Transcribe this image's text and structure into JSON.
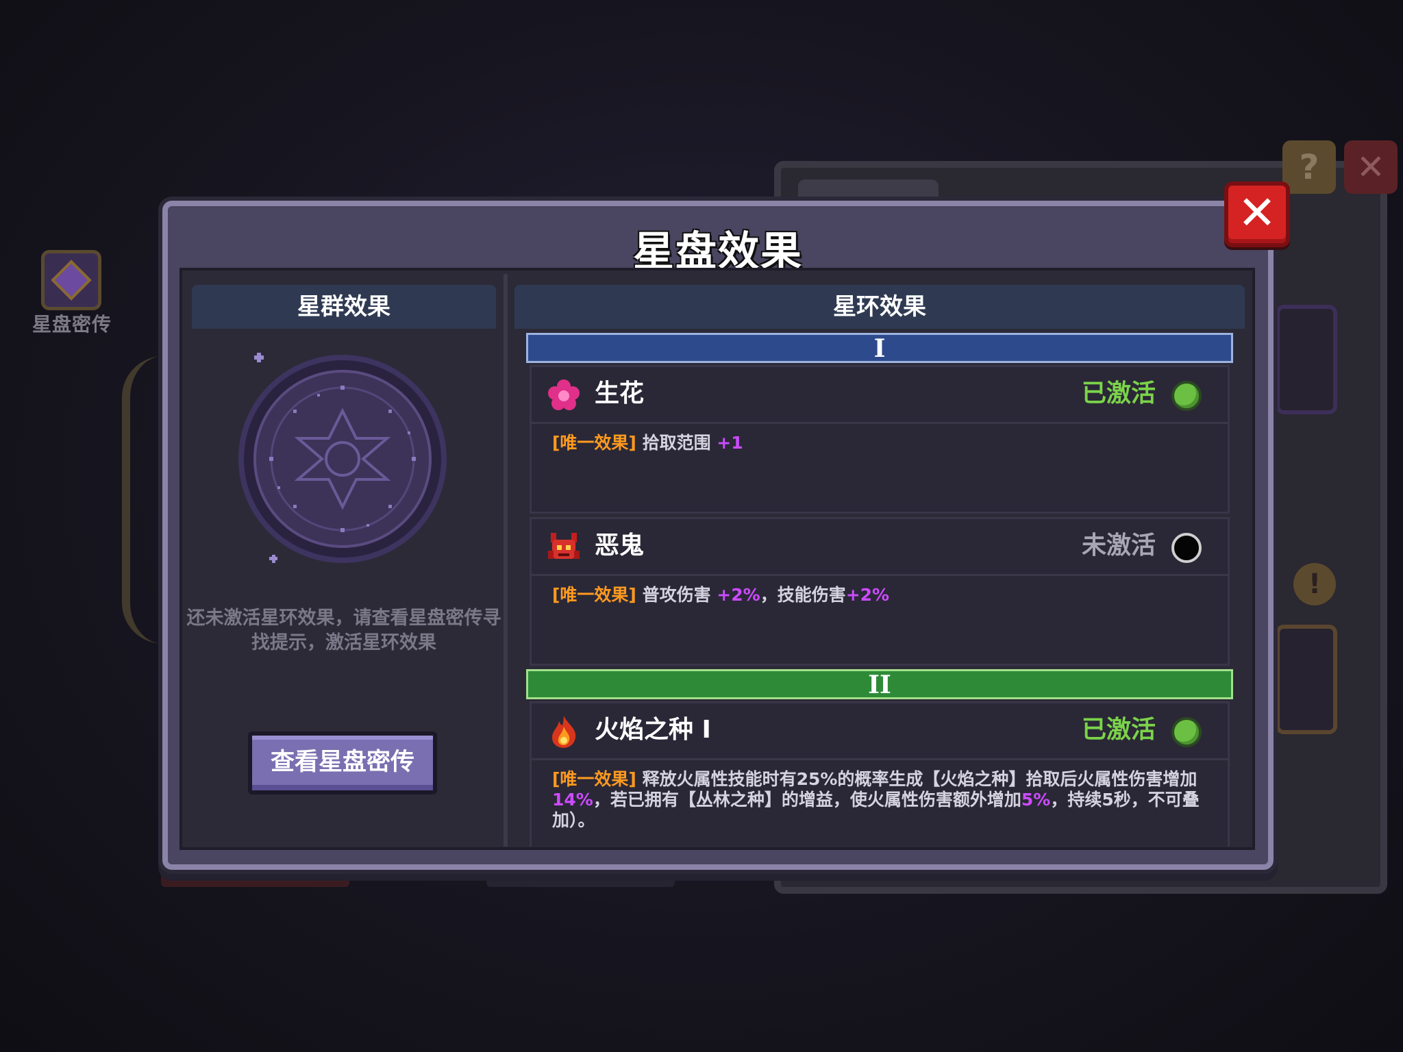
{
  "background": {
    "side_label": "星盘密传",
    "help_glyph": "?",
    "close_glyph": "✕",
    "warn_glyph": "!"
  },
  "dialog": {
    "title": "星盘效果",
    "close_glyph": "✕",
    "left": {
      "header": "星群效果",
      "hint": "还未激活星环效果，请查看星盘密传寻找提示，激活星环效果",
      "button": "查看星盘密传"
    },
    "right": {
      "header": "星环效果",
      "tiers": [
        {
          "label": "I",
          "color": "#2d4a8c",
          "effects": [
            {
              "name": "生花",
              "icon": "pink-flower-icon",
              "status": "已激活",
              "active": true,
              "status_color": "#7bd34a",
              "desc": [
                {
                  "text": "[唯一效果] ",
                  "style": "tag"
                },
                {
                  "text": "拾取范围 ",
                  "style": ""
                },
                {
                  "text": "+1",
                  "style": "hl"
                }
              ]
            },
            {
              "name": "恶鬼",
              "icon": "red-demon-icon",
              "status": "未激活",
              "active": false,
              "status_color": "#a9a6b4",
              "desc": [
                {
                  "text": "[唯一效果] ",
                  "style": "tag"
                },
                {
                  "text": "普攻伤害 ",
                  "style": ""
                },
                {
                  "text": "+2%",
                  "style": "hl"
                },
                {
                  "text": "，技能伤害",
                  "style": ""
                },
                {
                  "text": "+2%",
                  "style": "hl"
                }
              ]
            }
          ]
        },
        {
          "label": "II",
          "color": "#2e8a37",
          "effects": [
            {
              "name": "火焰之种 I",
              "icon": "fire-seed-icon",
              "status": "已激活",
              "active": true,
              "status_color": "#7bd34a",
              "desc": [
                {
                  "text": "[唯一效果] ",
                  "style": "tag"
                },
                {
                  "text": "释放火属性技能时有25%的概率生成【火焰之种】拾取后火属性伤害增加",
                  "style": ""
                },
                {
                  "text": "14%",
                  "style": "hl"
                },
                {
                  "text": "，若已拥有【丛林之种】的增益，使火属性伤害额外增加",
                  "style": ""
                },
                {
                  "text": "5%",
                  "style": "hl"
                },
                {
                  "text": "，持续5秒，不可叠加）。",
                  "style": ""
                }
              ]
            }
          ]
        }
      ]
    }
  }
}
